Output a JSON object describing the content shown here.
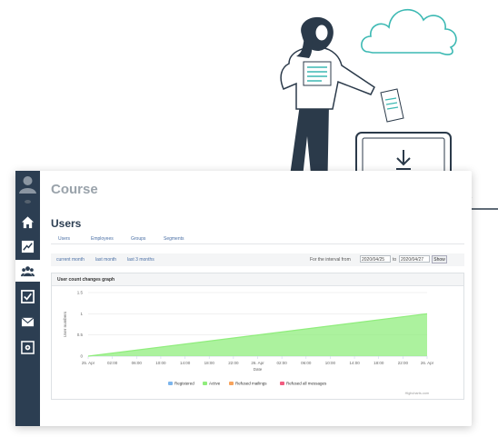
{
  "app": {
    "section_title": "Course",
    "page_title": "Users"
  },
  "sidebar": {
    "items": [
      {
        "name": "home",
        "icon": "home-icon"
      },
      {
        "name": "statistics",
        "icon": "chart-icon"
      },
      {
        "name": "users",
        "icon": "users-icon",
        "active": true
      },
      {
        "name": "tasks",
        "icon": "checkbox-icon"
      },
      {
        "name": "messages",
        "icon": "envelope-icon"
      },
      {
        "name": "settings",
        "icon": "gear-icon"
      }
    ]
  },
  "tabs": [
    {
      "label": "Users"
    },
    {
      "label": "Employees"
    },
    {
      "label": "Groups"
    },
    {
      "label": "Segments"
    }
  ],
  "period": {
    "links": [
      "current month",
      "last month",
      "last 3 months"
    ],
    "interval_label": "For the interval from",
    "from_date": "2020/04/25",
    "to_label": "to",
    "to_date": "2020/04/27",
    "show_label": "Show"
  },
  "graph": {
    "title": "User count changes graph",
    "credits": "Highcharts.com"
  },
  "chart_data": {
    "type": "area",
    "xlabel": "Date",
    "ylabel": "User numbers",
    "x_ticks": [
      "25. Apr",
      "02:00",
      "06:00",
      "10:00",
      "14:00",
      "18:00",
      "22:00",
      "26. Apr",
      "02:00",
      "06:00",
      "10:00",
      "14:00",
      "18:00",
      "22:00",
      "26. Apr"
    ],
    "y_ticks": [
      "0",
      "0.5",
      "1",
      "1.5"
    ],
    "ylim": [
      0,
      1.5
    ],
    "series": [
      {
        "name": "Registered",
        "color": "#7cb5ec",
        "values": [
          0,
          0
        ]
      },
      {
        "name": "Active",
        "color": "#90ed7d",
        "values": [
          0,
          1
        ]
      },
      {
        "name": "Refused mailings",
        "color": "#f7a35c",
        "values": [
          0,
          0
        ]
      },
      {
        "name": "Refused all messages",
        "color": "#f15c80",
        "values": [
          0,
          0
        ]
      }
    ],
    "legend_position": "bottom"
  },
  "colors": {
    "sidebar": "#2c3e52",
    "active_series": "#90ed7d",
    "illustration_line": "#2b3a4a",
    "illustration_accent": "#3cb9b3"
  }
}
